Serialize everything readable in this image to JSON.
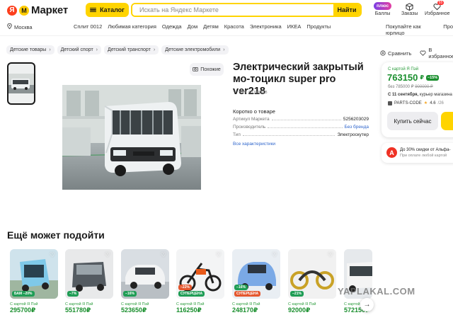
{
  "header": {
    "logo_ya": "Я",
    "logo_text": "Маркет",
    "catalog_label": "Каталог",
    "search_placeholder": "Искать на Яндекс Маркете",
    "search_button": "Найти",
    "plus_badge": "плюс",
    "plus_label": "Баллы",
    "orders_label": "Заказы",
    "favorites_label": "Избранное",
    "favorites_count": "55"
  },
  "nav": {
    "location": "Москва",
    "links": [
      "Сплит 0012",
      "Любимая категория",
      "Одежда",
      "Дом",
      "Детям",
      "Красота",
      "Электроника",
      "ИКЕА",
      "Продукты"
    ],
    "right_links": [
      "Покупайте как юрлицо",
      "Про"
    ]
  },
  "breadcrumbs": [
    "Детские товары",
    "Детский спорт",
    "Детский транспорт",
    "Детские электромобили"
  ],
  "actions": {
    "compare": "Сравнить",
    "favorite": "В избранное"
  },
  "gallery": {
    "similar_label": "Похожие"
  },
  "product": {
    "title": "Электрический закрытый мо-тоцикл super pro ver218",
    "reviews": "Нет отзывов",
    "about_heading": "Коротко о товаре",
    "specs": [
      {
        "key": "Артикул Маркета",
        "value": "5256203029"
      },
      {
        "key": "Производитель",
        "value": "Без бренда"
      },
      {
        "key": "Тип",
        "value": "Электроскутер"
      }
    ],
    "all_specs": "Все характеристики"
  },
  "price_card": {
    "label": "С картой Я Пэй",
    "price": "763150",
    "currency": "₽",
    "discount": "−15%",
    "old_prefix": "без",
    "old_price": "785000 ₽",
    "strike_price": "900000 ₽",
    "delivery_date": "С 11 сентября,",
    "delivery_rest": "курьер магазина",
    "shop_name": "PARTS-CODE",
    "shop_rating": "4.6",
    "shop_reviews": "/26",
    "buy_label": "Купить сейчас"
  },
  "alfa": {
    "logo": "А",
    "line1": "До 30% скидки от Альфа-",
    "line2": "При оплате любой картой"
  },
  "recommendations": {
    "title": "Ещё может подойти",
    "card_label": "С картой Я Пэй",
    "items": [
      {
        "price": "295700",
        "badge": "БАМ −20%",
        "badge_color": "#1f9d55"
      },
      {
        "price": "551780",
        "badge": "−7%",
        "badge_color": "#1f9d55"
      },
      {
        "price": "523650",
        "badge": "−16%",
        "badge_color": "#1f9d55"
      },
      {
        "price": "116250",
        "badge": "−22%",
        "badge_color": "#1f9d55",
        "top_badge": "СУПЕРЦЕНА"
      },
      {
        "price": "248170",
        "badge": "СУПЕРЦЕНА",
        "badge_color": "#e4572e",
        "top_badge": "−16%"
      },
      {
        "price": "92000",
        "badge": "−21%",
        "badge_color": "#1f9d55"
      },
      {
        "price": "572150",
        "badge": "",
        "badge_color": "#1f9d55"
      }
    ],
    "currency": "₽"
  },
  "watermark": "YAPLAKAL.COM",
  "colors": {
    "accent": "#ffd400",
    "price_green": "#1a8f2e",
    "link_blue": "#2f66cc"
  }
}
